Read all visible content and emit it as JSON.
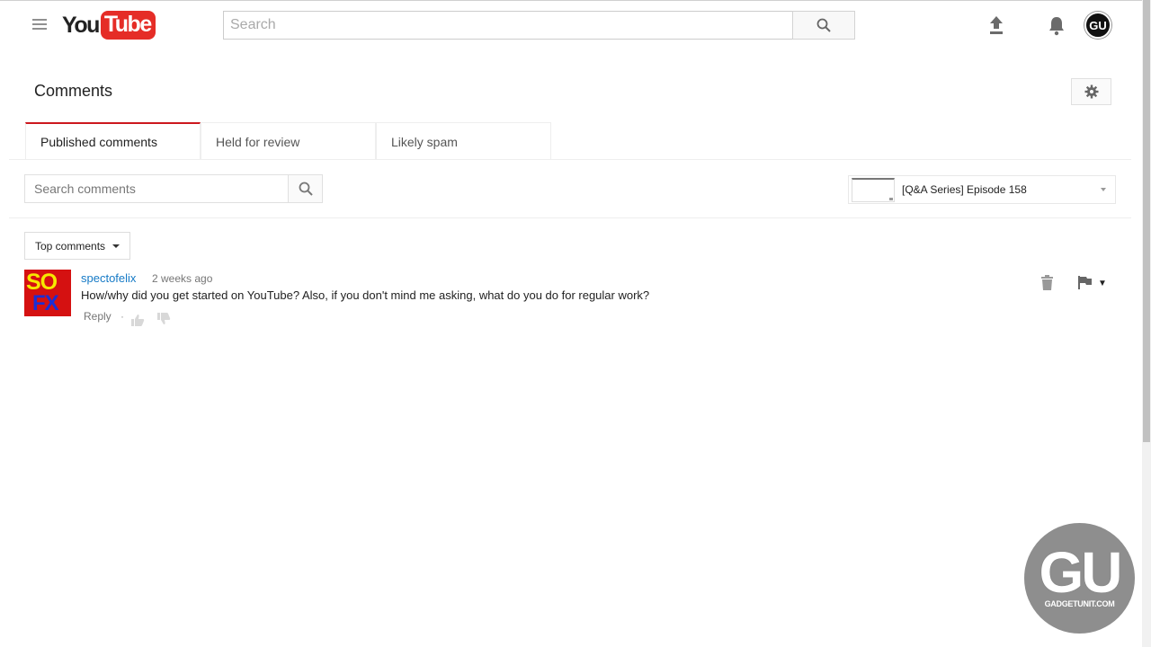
{
  "header": {
    "logo_you": "You",
    "logo_tube": "Tube",
    "search_placeholder": "Search",
    "account_initials": "GU"
  },
  "page": {
    "title": "Comments"
  },
  "tabs": [
    {
      "label": "Published comments",
      "active": true
    },
    {
      "label": "Held for review",
      "active": false
    },
    {
      "label": "Likely spam",
      "active": false
    }
  ],
  "filters": {
    "search_placeholder": "Search comments",
    "video_title": "[Q&A Series] Episode 158",
    "sort_label": "Top comments"
  },
  "comments": [
    {
      "author": "spectofelix",
      "avatar_top": "SO",
      "avatar_bottom": "FX",
      "time": "2 weeks ago",
      "text": "How/why did you get started on YouTube? Also, if you don't mind me asking, what do you do for regular work?",
      "reply_label": "Reply",
      "separator": "·"
    }
  ],
  "watermark": {
    "main": "GU",
    "sub": "GADGETUNIT.COM"
  },
  "colors": {
    "brand_red": "#e52d27",
    "tab_active": "#cc181e",
    "link_blue": "#167ac6"
  }
}
